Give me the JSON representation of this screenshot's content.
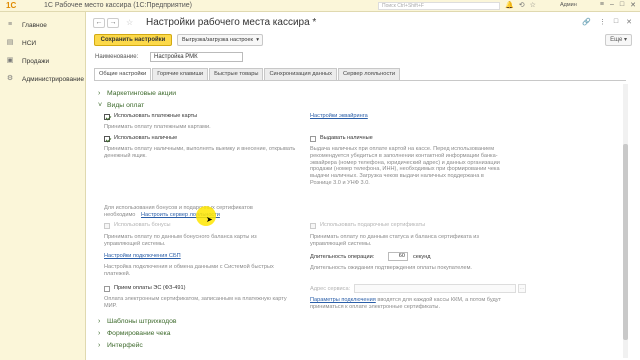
{
  "app": {
    "logo": "1С",
    "title": "1С Рабочее место кассира  (1С:Предприятие)",
    "search_placeholder": "Поиск Ctrl+Shift+F",
    "user": "Админ"
  },
  "sidebar": {
    "items": [
      {
        "label": "Главное",
        "icon": "menu-icon"
      },
      {
        "label": "НСИ",
        "icon": "book-icon"
      },
      {
        "label": "Продажи",
        "icon": "cart-icon"
      },
      {
        "label": "Администрирование",
        "icon": "gear-icon"
      }
    ]
  },
  "form": {
    "title": "Настройки рабочего места кассира *",
    "save_label": "Сохранить настройки",
    "export_label": "Выгрузка/загрузка настроек",
    "more_label": "Еще",
    "name_label": "Наименование:",
    "name_value": "Настройка РМК",
    "tabs": [
      "Общие настройки",
      "Горячие клавиши",
      "Быстрые товары",
      "Синхронизация данных",
      "Сервер лояльности"
    ]
  },
  "content": {
    "sections": {
      "marketing": "Маркетинговые акции",
      "payments": "Виды оплат",
      "barcodes": "Шаблоны штрихкодов",
      "receipt": "Формирование чека",
      "interface": "Интерфейс"
    },
    "cards": {
      "label": "Использовать платежные карты",
      "desc": "Принимать оплату платежными картами.",
      "link": "Настройки эквайринга"
    },
    "cash": {
      "label": "Использовать наличные",
      "desc": "Принимать оплату наличными, выполнять выемку и внесение, открывать денежный ящик.",
      "issue_label": "Выдавать наличные",
      "issue_desc": "Выдача наличных при оплате картой на кассе. Перед использованием рекомендуется убедиться в заполнении контактной информации банка-эквайрера (номер телефона, юридический адрес) и данных организации продажи (номер телефона, ИНН), необходимых при формировании чека выдачи наличных. Загрузка чеков выдачи наличных поддержана в Рознице 3.0 и УНФ 3.0."
    },
    "bonus_note": "Для использования бонусов и подарочных сертификатов необходимо",
    "bonus_link": "Настроить сервер лояльности",
    "bonuses": {
      "label": "Использовать бонусы",
      "desc": "Принимать оплату по данным бонусного баланса карты из управляющей системы."
    },
    "gift": {
      "label": "Использовать подарочные сертификаты",
      "desc": "Принимать оплату по данным статуса и баланса сертификата из управляющей системы."
    },
    "sbp": {
      "link": "Настройки подключения СБП",
      "desc": "Настройка подключения и обмена данными с Системой быстрых платежей."
    },
    "duration": {
      "label": "Длительность операции:",
      "value": "60",
      "unit": "секунд",
      "desc": "Длительность ожидания подтверждения оплаты покупателем."
    },
    "es": {
      "label": "Прием оплаты ЭС (ФЗ-491)",
      "desc": "Оплата электронным сертификатом, записанным на платежную карту МИР."
    },
    "service": {
      "label": "Адрес сервиса:",
      "link": "Параметры подключения",
      "desc": "вводятся для каждой кассы ККМ, а потом будут приниматься к оплате электронные сертификаты."
    }
  }
}
